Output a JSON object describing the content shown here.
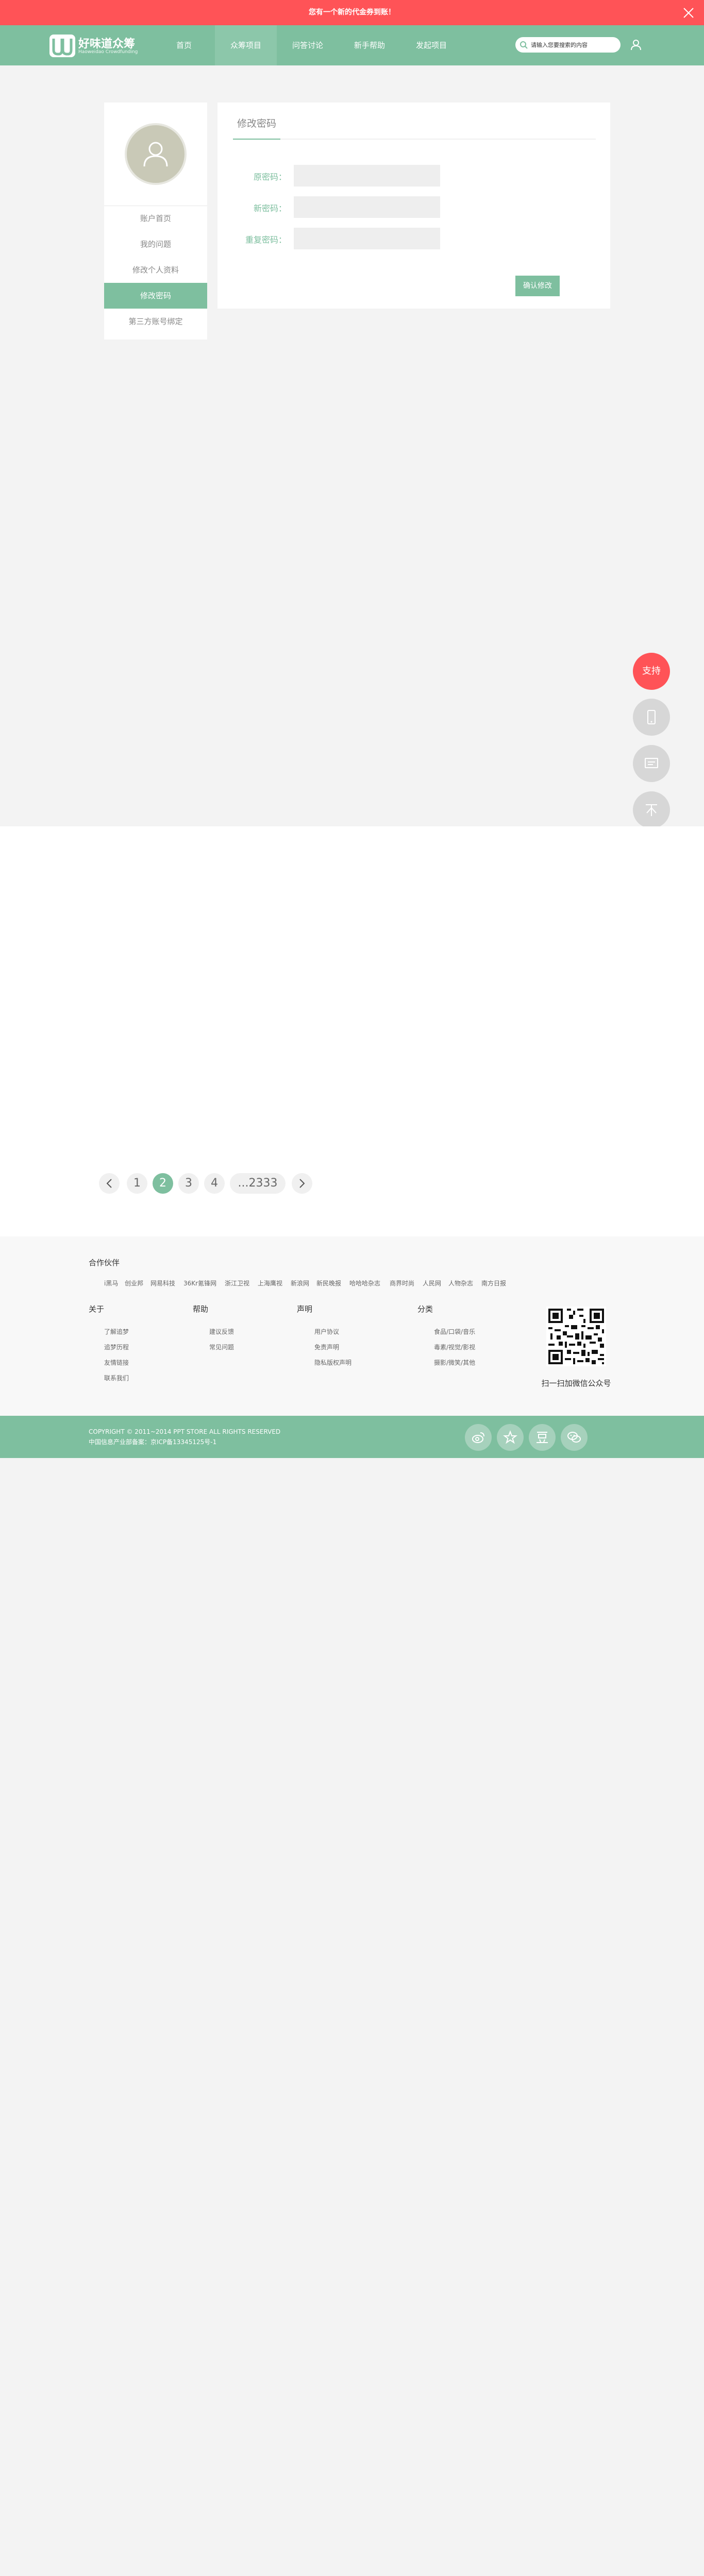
{
  "banner": {
    "text": "您有一个新的代金券到账！"
  },
  "brand": {
    "name": "好味道众筹",
    "subtitle": "Haoweidao Crowdfunding"
  },
  "nav": {
    "items": [
      {
        "label": "首页"
      },
      {
        "label": "众筹项目"
      },
      {
        "label": "问答讨论"
      },
      {
        "label": "新手帮助"
      },
      {
        "label": "发起项目"
      }
    ],
    "active_index": 1
  },
  "search": {
    "placeholder": "请输入您要搜索的内容"
  },
  "sidebar": {
    "items": [
      {
        "label": "账户首页"
      },
      {
        "label": "我的问题"
      },
      {
        "label": "修改个人资料"
      },
      {
        "label": "修改密码"
      },
      {
        "label": "第三方账号绑定"
      }
    ],
    "active_index": 3
  },
  "panel": {
    "title": "修改密码",
    "fields": [
      {
        "label": "原密码：",
        "value": ""
      },
      {
        "label": "新密码：",
        "value": ""
      },
      {
        "label": "重复密码：",
        "value": ""
      }
    ],
    "confirm_label": "确认修改"
  },
  "float_buttons": [
    {
      "label": "支持",
      "icon": "support"
    },
    {
      "label": "",
      "icon": "phone-icon"
    },
    {
      "label": "",
      "icon": "message-icon"
    },
    {
      "label": "",
      "icon": "back-to-top-icon"
    }
  ],
  "pagination": {
    "pages": [
      "1",
      "2",
      "3",
      "4"
    ],
    "current": "2",
    "last": "...2333"
  },
  "footer": {
    "partners_title": "合作伙伴",
    "partners": [
      "i黑马",
      "创业邦",
      "网易科技",
      "36Kr氪锋网",
      "浙江卫视",
      "上海鹰视",
      "新浪网",
      "新民晚报",
      "哈哈哈杂志",
      "商界时尚",
      "人民网",
      "人物杂志",
      "南方日报"
    ],
    "columns": [
      {
        "title": "关于",
        "links": [
          "了解追梦",
          "追梦历程",
          "友情链接",
          "联系我们"
        ]
      },
      {
        "title": "帮助",
        "links": [
          "建议反馈",
          "常见问题"
        ]
      },
      {
        "title": "声明",
        "links": [
          "用户协议",
          "免责声明",
          "隐私版权声明"
        ]
      },
      {
        "title": "分类",
        "links": [
          "食品/口袋/音乐",
          "毒素/视觉/影视",
          "摄影/微笑/其他"
        ]
      }
    ],
    "qr_caption": "扫一扫加微信公众号",
    "copyright": "COPYRIGHT © 2011~2014 PPT STORE ALL RIGHTS RESERVED",
    "icp": "中国信息产业部备案：京ICP备13345125号-1"
  },
  "social_icons": [
    "weibo-icon",
    "star-icon",
    "douban-icon",
    "wechat-icon"
  ],
  "colors": {
    "accent": "#7ebf9f",
    "alert": "#ff5357"
  }
}
